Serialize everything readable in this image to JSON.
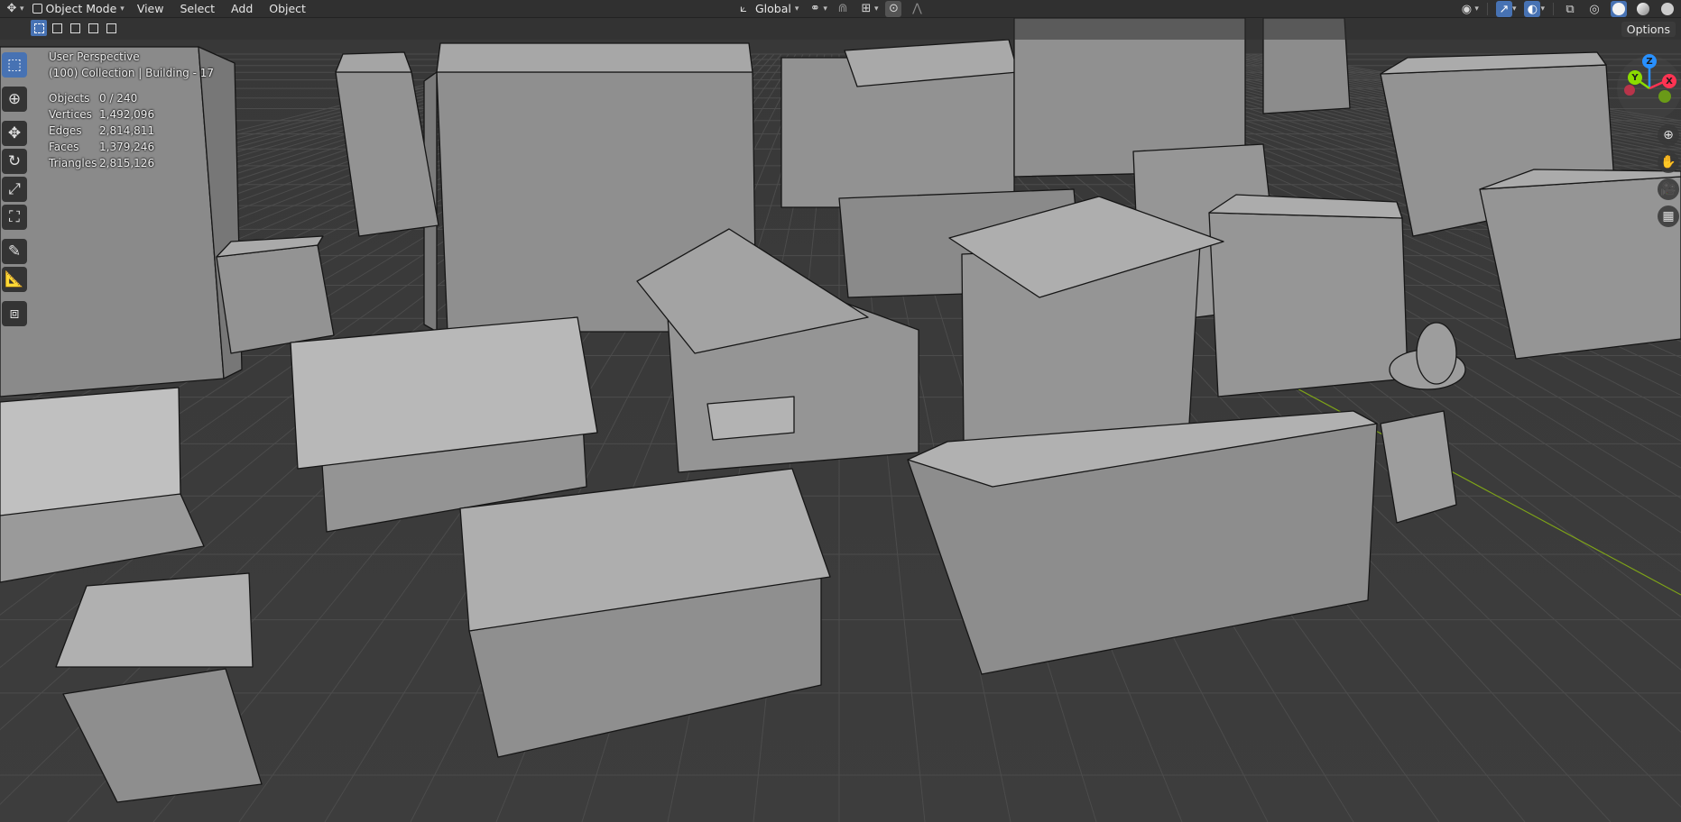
{
  "header": {
    "editor_type_icon": "axes-icon",
    "mode": "Object Mode",
    "menus": [
      "View",
      "Select",
      "Add",
      "Object"
    ],
    "orientation": "Global"
  },
  "overlay": {
    "perspective": "User Perspective",
    "collection": "(100) Collection | Building - 17",
    "stats": [
      {
        "label": "Objects",
        "value": "0 / 240"
      },
      {
        "label": "Vertices",
        "value": "1,492,096"
      },
      {
        "label": "Edges",
        "value": "2,814,811"
      },
      {
        "label": "Faces",
        "value": "1,379,246"
      },
      {
        "label": "Triangles",
        "value": "2,815,126"
      }
    ]
  },
  "options_label": "Options",
  "gizmo": {
    "x": "X",
    "y": "Y",
    "z": "Z"
  },
  "toolbar": {
    "tools": [
      "select-box-icon",
      "cursor-icon",
      "move-icon",
      "rotate-icon",
      "scale-icon",
      "transform-icon",
      "annotate-icon",
      "measure-icon",
      "add-cube-icon"
    ]
  },
  "colors": {
    "accent": "#4772b3",
    "x_axis": "#ff3352",
    "y_axis": "#8bdc00",
    "z_axis": "#2890ff",
    "grid": "#4a4a4a",
    "building_face": "#9a9a9a",
    "building_edge": "#1a1a1a"
  }
}
